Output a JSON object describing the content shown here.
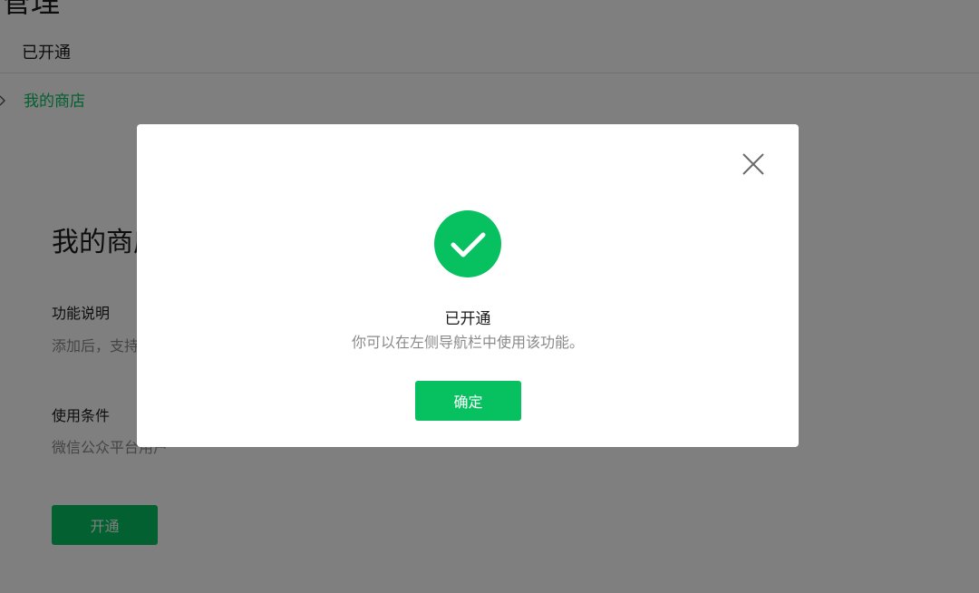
{
  "header": {
    "title": "管理",
    "section_label": "已开通"
  },
  "nav": {
    "active_item": "我的商店",
    "icon": "chevron-right-icon"
  },
  "card": {
    "title": "我的商店",
    "description_label": "功能说明",
    "description_value": "添加后，支持",
    "requirement_label": "使用条件",
    "requirement_value": "微信公众平台用户",
    "open_button_label": "开通"
  },
  "dialog": {
    "close_icon": "close-icon",
    "status_icon": "check-circle-icon",
    "title": "已开通",
    "description": "你可以在左侧导航栏中使用该功能。",
    "confirm_label": "确定"
  },
  "colors": {
    "accent": "#07c160",
    "overlay": "rgba(0,0,0,0.5)",
    "muted_text": "#8a8a8a"
  }
}
